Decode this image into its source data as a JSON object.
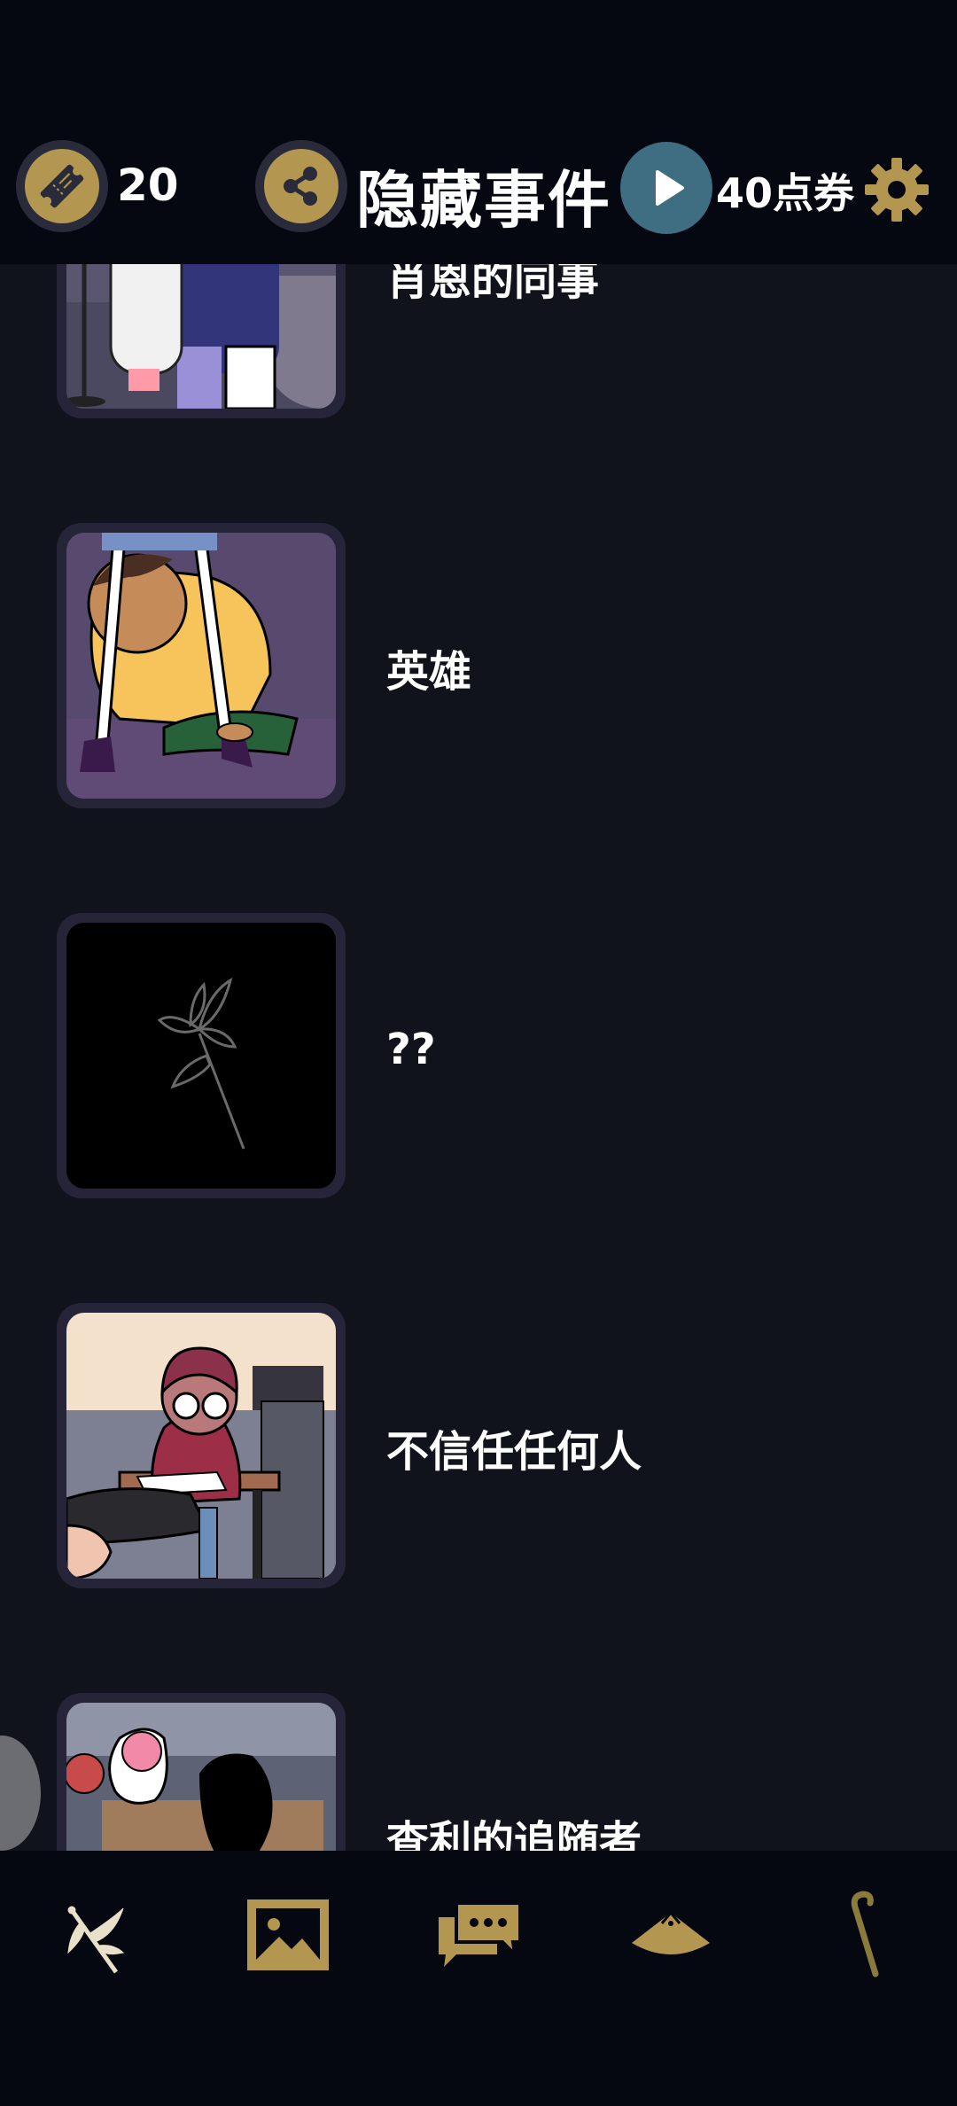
{
  "header": {
    "ticket_count": "20",
    "title": "隐藏事件",
    "coupon_label": "40点券"
  },
  "events": [
    {
      "label": "肖恩的同事"
    },
    {
      "label": "英雄"
    },
    {
      "label": "??"
    },
    {
      "label": "不信任任何人"
    },
    {
      "label": "查利的追随者"
    }
  ],
  "bottom_nav": {
    "items": [
      {
        "icon": "flower-branch-icon"
      },
      {
        "icon": "gallery-image-icon"
      },
      {
        "icon": "chat-bubbles-icon"
      },
      {
        "icon": "hat-icon"
      },
      {
        "icon": "cane-icon"
      }
    ]
  },
  "colors": {
    "accent_gold": "#b39650",
    "background": "#11131c",
    "bar_background": "#050810",
    "play_button": "#3f6e82"
  }
}
